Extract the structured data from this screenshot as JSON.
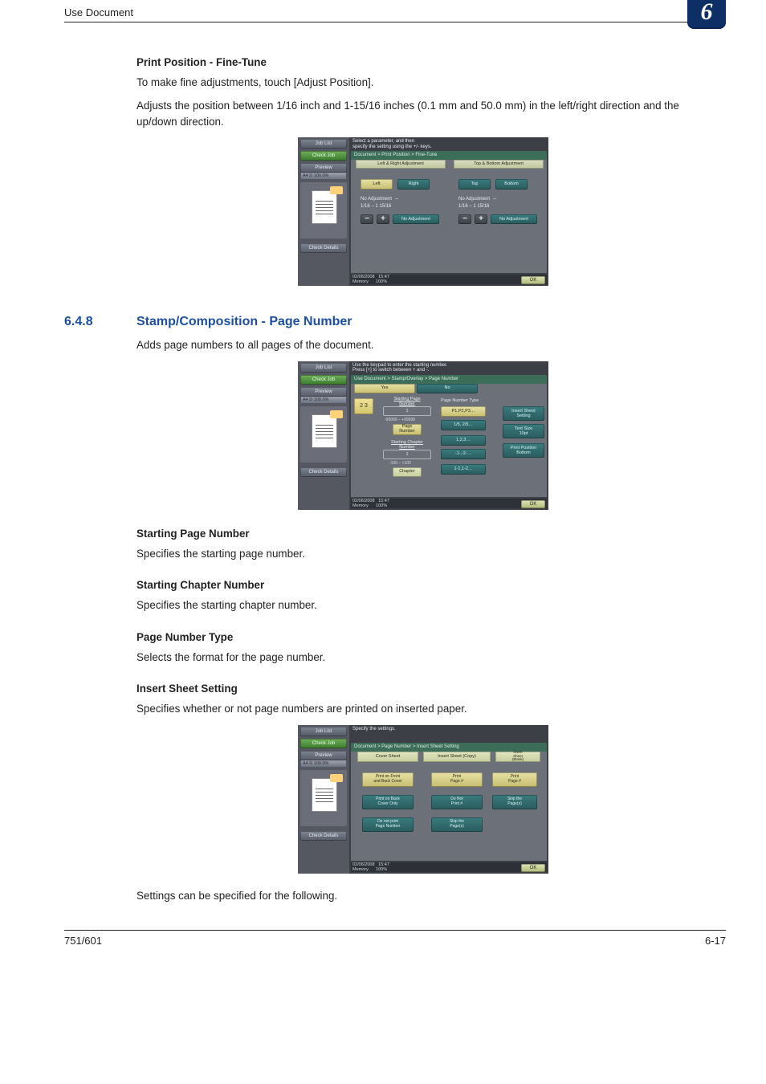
{
  "header": {
    "left": "Use Document",
    "badge": "6"
  },
  "intro1": {
    "heading": "Print Position - Fine-Tune",
    "p1": "To make fine adjustments, touch [Adjust Position].",
    "p2": "Adjusts the position between 1/16 inch and 1-15/16 inches (0.1 mm and 50.0 mm) in the left/right direction and the up/down direction."
  },
  "section": {
    "num": "6.4.8",
    "title": "Stamp/Composition - Page Number",
    "lead": "Adds page numbers to all pages of the document."
  },
  "sub": {
    "spn_h": "Starting Page Number",
    "spn_b": "Specifies the starting page number.",
    "scn_h": "Starting Chapter Number",
    "scn_b": "Specifies the starting chapter number.",
    "pnt_h": "Page Number Type",
    "pnt_b": "Selects the format for the page number.",
    "iss_h": "Insert Sheet Setting",
    "iss_b": "Specifies whether or not page numbers are printed on inserted paper."
  },
  "trailing": "Settings can be specified for the following.",
  "footer": {
    "left": "751/601",
    "right": "6-17"
  },
  "ui_common": {
    "job_list": "Job List",
    "check_job": "Check Job",
    "preview": "Preview",
    "preview_label": "A4 D    100.0%",
    "check_details": "Check Details",
    "ok": "OK",
    "date": "02/06/2008",
    "time": "15:47",
    "memory": "Memory",
    "mem_pct": "100%"
  },
  "shot1": {
    "msg": "Select a parameter, and then\nspecify the setting using the +/- keys.",
    "crumb": "Document > Print Position > Fine-Tune",
    "left_hdr": "Left & Right Adjustment",
    "right_hdr": "Top & Bottom Adjustment",
    "left": "Left",
    "right": "Right",
    "top": "Top",
    "bottom": "Bottom",
    "no_adj": "No Adjustment",
    "unit_row1": "⇔",
    "range": "1/16          –           1 15/16",
    "minus": "−",
    "plus": "+"
  },
  "shot2": {
    "msg": "Use the keypad to enter the starting number.\nPress [+] to switch between + and -.",
    "crumb": "Use Document > Stamp/Overlay > Page Number",
    "yes": "Yes",
    "no": "No",
    "kp": "2 3",
    "spn_lbl": "Starting Page\nNumber",
    "spn_val": "1",
    "spn_rng": "-99999    –    +99999",
    "spn_btn": "Page\nNumber",
    "scn_lbl": "Starting Chapter\nNumber",
    "scn_val": "1",
    "scn_rng": "-100    –    +100",
    "scn_btn": "Chapter",
    "pnt_lbl": "Page Number Type",
    "opts": [
      "P1,P2,P3…",
      "1/5, 2/5…",
      "1,2,3…",
      "-1-,-2-…",
      "1-1,1-2…"
    ],
    "side": {
      "insert": "Insert Sheet\nSetting",
      "text": "Text Size\n10pt",
      "pos": "Print Position\nBottom"
    }
  },
  "shot3": {
    "msg": "Specify the settings.",
    "crumb": "Document > Page Number > Insert Sheet Setting",
    "col1": "Cover Sheet",
    "col2": "Insert Sheet (Copy)",
    "col3": "Insert\nSheet\n(Blank)",
    "c1a": "Print on Front\nand Back Cover",
    "c1b": "Print on Back\nCover Only",
    "c1c": "Do not print\nPage Number",
    "c2a": "Print\nPage #",
    "c2b": "Do Not\nPrint #",
    "c2c": "Skip the\nPage(s)",
    "c3a": "Print\nPage #",
    "c3b": "Skip the\nPage(s)"
  },
  "chart_data": null
}
